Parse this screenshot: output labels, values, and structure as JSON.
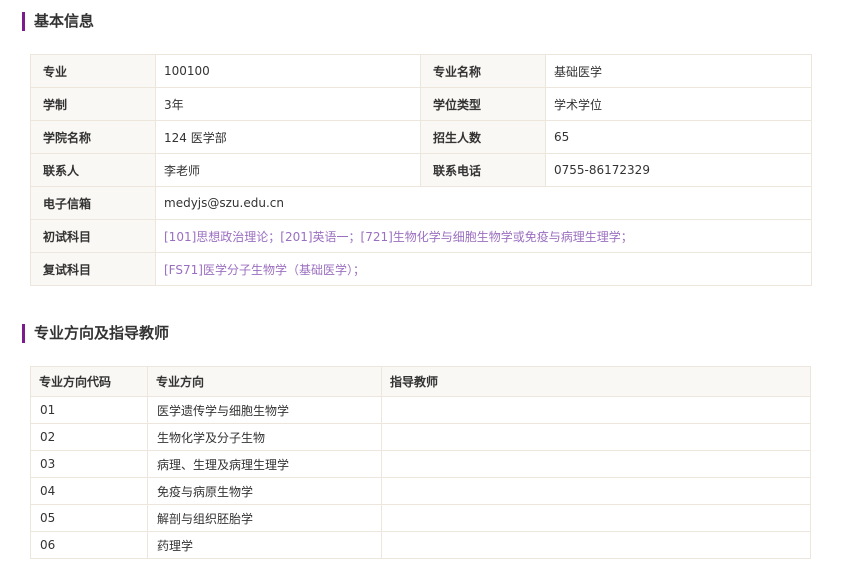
{
  "basic_info": {
    "title": "基本信息",
    "rows": [
      {
        "l1": "专业",
        "v1": "100100",
        "l2": "专业名称",
        "v2": "基础医学"
      },
      {
        "l1": "学制",
        "v1": "3年",
        "l2": "学位类型",
        "v2": "学术学位"
      },
      {
        "l1": "学院名称",
        "v1": "124 医学部",
        "l2": "招生人数",
        "v2": "65"
      },
      {
        "l1": "联系人",
        "v1": "李老师",
        "l2": "联系电话",
        "v2": "0755-86172329"
      }
    ],
    "email_label": "电子信箱",
    "email": "medyjs@szu.edu.cn",
    "prelim_label": "初试科目",
    "prelim": "[101]思想政治理论；[201]英语一；[721]生物化学与细胞生物学或免疫与病理生理学；",
    "retest_label": "复试科目",
    "retest": "[FS71]医学分子生物学（基础医学）；"
  },
  "directions": {
    "title": "专业方向及指导教师",
    "headers": [
      "专业方向代码",
      "专业方向",
      "指导教师"
    ],
    "rows": [
      {
        "code": "01",
        "name": "医学遗传学与细胞生物学",
        "teacher": ""
      },
      {
        "code": "02",
        "name": "生物化学及分子生物",
        "teacher": ""
      },
      {
        "code": "03",
        "name": "病理、生理及病理生理学",
        "teacher": ""
      },
      {
        "code": "04",
        "name": "免疫与病原生物学",
        "teacher": ""
      },
      {
        "code": "05",
        "name": "解剖与组织胚胎学",
        "teacher": ""
      },
      {
        "code": "06",
        "name": "药理学",
        "teacher": ""
      }
    ]
  },
  "colors": {
    "accent": "#7b1c8e",
    "link": "#9b6fc0",
    "label_bg": "#faf8f4",
    "border": "#ede6dc"
  }
}
